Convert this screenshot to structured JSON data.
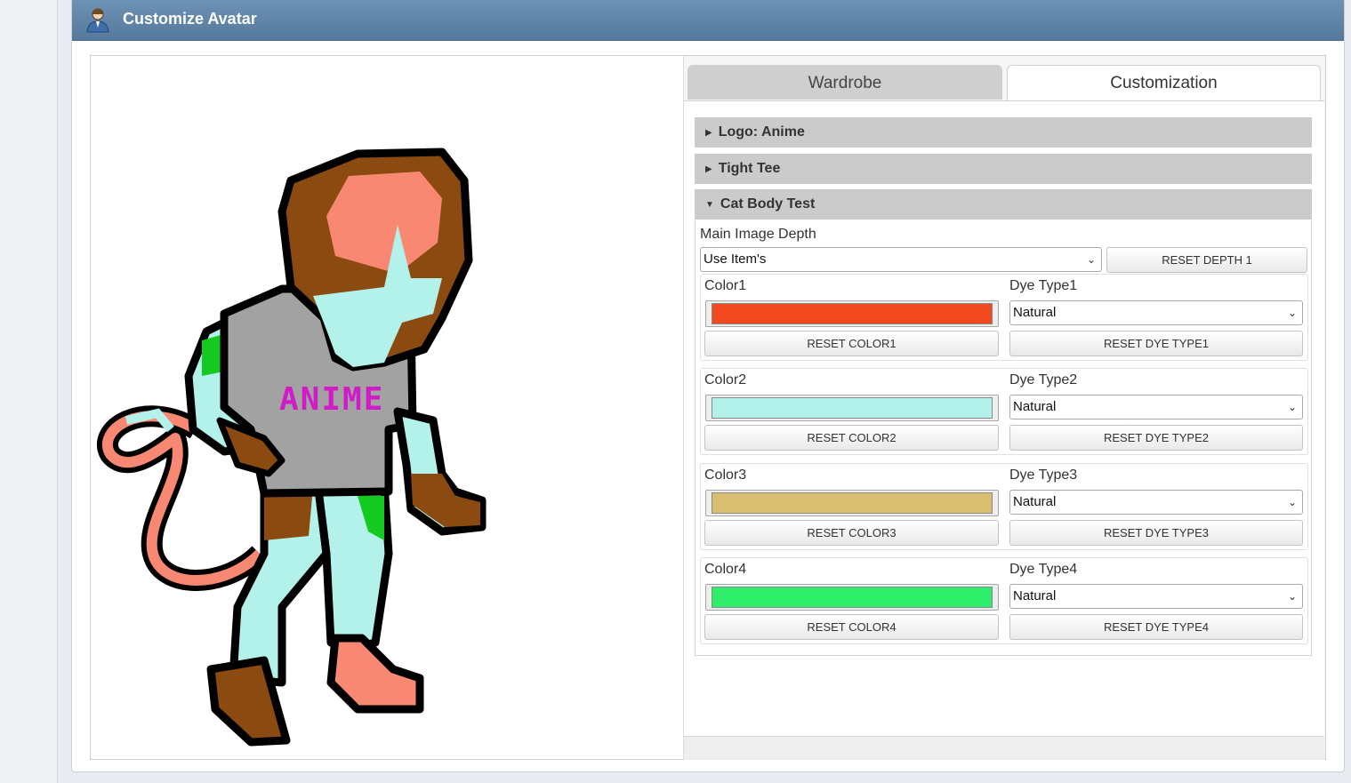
{
  "window": {
    "title": "Customize Avatar"
  },
  "tabs": [
    {
      "label": "Wardrobe",
      "active": false
    },
    {
      "label": "Customization",
      "active": true
    }
  ],
  "accordion": [
    {
      "label": "Logo: Anime",
      "expanded": false
    },
    {
      "label": "Tight Tee",
      "expanded": false
    },
    {
      "label": "Cat Body Test",
      "expanded": true
    }
  ],
  "depth": {
    "label": "Main Image Depth",
    "selected": "Use Item's",
    "reset_label": "RESET DEPTH 1"
  },
  "colors": [
    {
      "label": "Color1",
      "value": "#f24a1f",
      "reset_label": "RESET COLOR1",
      "dye_label": "Dye Type1",
      "dye_value": "Natural",
      "dye_reset_label": "RESET DYE TYPE1"
    },
    {
      "label": "Color2",
      "value": "#b3f2ea",
      "reset_label": "RESET COLOR2",
      "dye_label": "Dye Type2",
      "dye_value": "Natural",
      "dye_reset_label": "RESET DYE TYPE2"
    },
    {
      "label": "Color3",
      "value": "#d9be72",
      "reset_label": "RESET COLOR3",
      "dye_label": "Dye Type3",
      "dye_value": "Natural",
      "dye_reset_label": "RESET DYE TYPE3"
    },
    {
      "label": "Color4",
      "value": "#2ded6b",
      "reset_label": "RESET COLOR4",
      "dye_label": "Dye Type4",
      "dye_value": "Natural",
      "dye_reset_label": "RESET DYE TYPE4"
    }
  ],
  "avatar": {
    "logo_text": "ANIME",
    "logo_color": "#d11bc9",
    "fur_color": "#8b4a10",
    "skin_color": "#b3f2ea",
    "pink_color": "#f98872",
    "shirt_color": "#a2a2a2",
    "accent_color": "#14c91f"
  }
}
